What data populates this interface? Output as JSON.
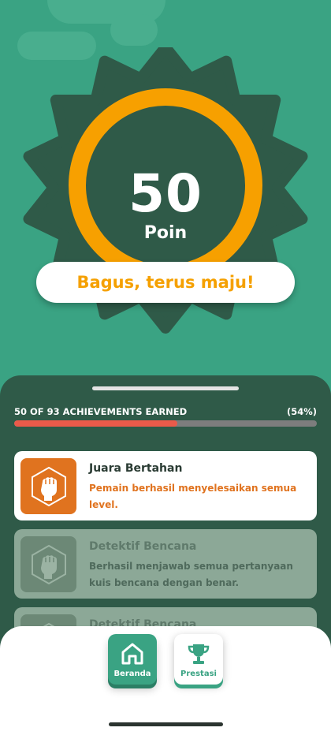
{
  "score": {
    "value": "50",
    "unit": "Poin"
  },
  "motto": "Bagus, terus maju!",
  "progress": {
    "label": "50 OF 93 ACHIEVEMENTS EARNED",
    "percent_label": "(54%)",
    "fraction": 0.54
  },
  "achievements": [
    {
      "title": "Juara Bertahan",
      "description": "Pemain berhasil menyelesaikan semua level.",
      "state": "earned",
      "icon": "fist-icon"
    },
    {
      "title": "Detektif Bencana",
      "description": "Berhasil menjawab semua pertanyaan kuis bencana dengan benar.",
      "state": "locked",
      "icon": "fist-icon"
    },
    {
      "title": "Detektif Bencana",
      "description": "",
      "state": "locked",
      "icon": "fist-icon"
    }
  ],
  "nav": {
    "home": {
      "label": "Beranda",
      "icon": "home-icon"
    },
    "achievements": {
      "label": "Prestasi",
      "icon": "trophy-icon"
    }
  },
  "colors": {
    "background": "#3aa383",
    "badge": "#2f5a48",
    "ring": "#f7a000",
    "accent_orange": "#e0731f",
    "progress_fill": "#ea5a4a"
  }
}
